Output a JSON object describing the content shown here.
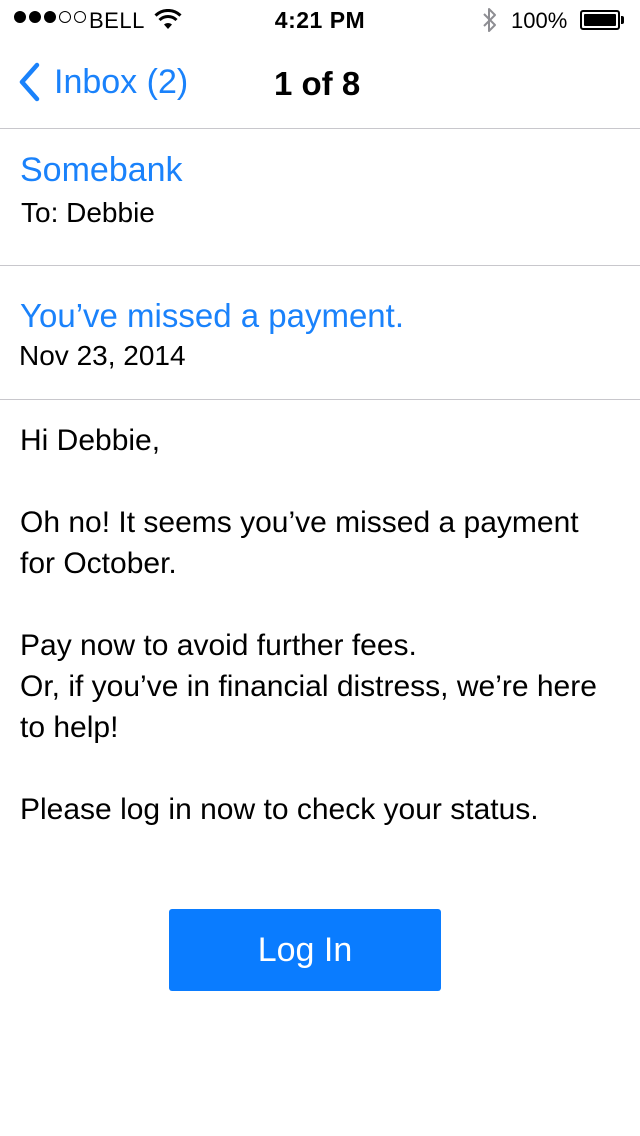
{
  "status_bar": {
    "signal_dots_filled": 3,
    "signal_dots_total": 5,
    "carrier": "BELL",
    "time": "4:21 PM",
    "battery_percent": "100%",
    "battery_level": 1.0,
    "icons": [
      "wifi-icon",
      "bluetooth-icon",
      "battery-icon"
    ]
  },
  "nav": {
    "back_label": "Inbox (2)",
    "title": "1 of 8"
  },
  "email": {
    "sender": "Somebank",
    "recipient_line": "To: Debbie",
    "subject": "You’ve missed a payment.",
    "date": "Nov 23, 2014",
    "body": {
      "greeting": "Hi Debbie,",
      "paragraph_1": "Oh no! It seems you’ve missed a payment for October.",
      "paragraph_2_line_1": "Pay now to avoid further fees.",
      "paragraph_2_line_2": "Or, if you’ve in financial distress, we’re here to help!",
      "paragraph_3": "Please log in now to check your status."
    },
    "button_label": "Log In"
  },
  "colors": {
    "accent": "#1a82fb",
    "button": "#0a7cff",
    "divider": "#c8c7cc"
  }
}
